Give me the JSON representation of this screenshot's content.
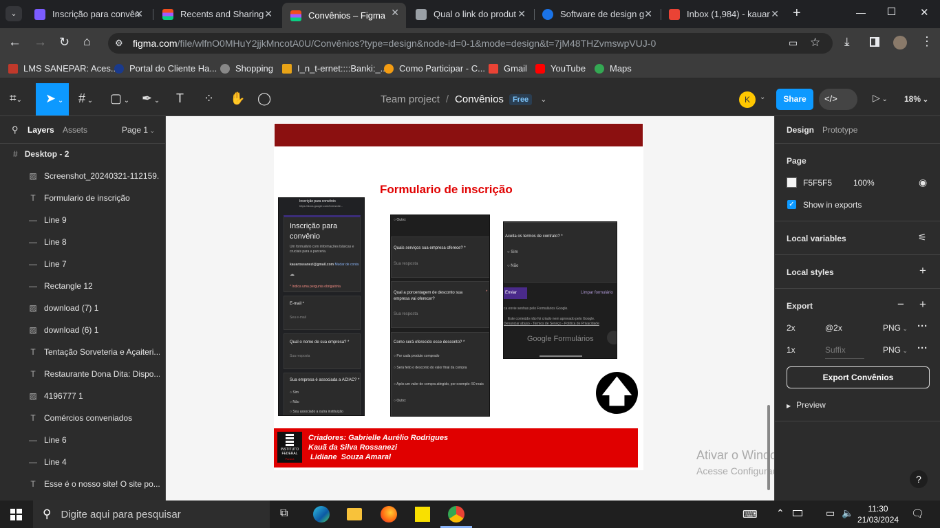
{
  "browser": {
    "tabs": [
      {
        "title": "Inscrição para convên",
        "color": "#7b5cff"
      },
      {
        "title": "Recents and Sharing -",
        "color": "#f24e1e"
      },
      {
        "title": "Convênios – Figma",
        "color": "#f24e1e"
      },
      {
        "title": "Qual o link do produt",
        "color": "#9aa0a6"
      },
      {
        "title": "Software de design g",
        "color": "#1a73e8"
      },
      {
        "title": "Inbox (1,984) - kauar",
        "color": "#ea4335"
      }
    ],
    "new_tab": "+",
    "url_host": "figma.com",
    "url_path": "/file/wlfnO0MHuY2jjkMncotA0U/Convênios?type=design&node-id=0-1&mode=design&t=7jM48THZvmswpVUJ-0",
    "bookmarks": [
      "LMS SANEPAR: Aces...",
      "Portal do Cliente Ha...",
      "Shopping",
      "I_n_t-ernet::::Banki:_...",
      "Como Participar - C...",
      "Gmail",
      "YouTube",
      "Maps"
    ]
  },
  "figma": {
    "breadcrumb_team": "Team project",
    "breadcrumb_sep": "/",
    "file_name": "Convênios",
    "plan_badge": "Free",
    "avatar_letter": "K",
    "share_label": "Share",
    "zoom": "18%",
    "left": {
      "tab_layers": "Layers",
      "tab_assets": "Assets",
      "page": "Page 1",
      "frame": "Desktop - 2",
      "layers": [
        {
          "icon": "image",
          "name": "Screenshot_20240321-112159..."
        },
        {
          "icon": "text",
          "name": "Formulario de inscrição"
        },
        {
          "icon": "line",
          "name": "Line 9"
        },
        {
          "icon": "line",
          "name": "Line 8"
        },
        {
          "icon": "line",
          "name": "Line 7"
        },
        {
          "icon": "line",
          "name": "Rectangle 12"
        },
        {
          "icon": "image",
          "name": "download (7) 1"
        },
        {
          "icon": "image",
          "name": "download (6) 1"
        },
        {
          "icon": "text",
          "name": "Tentação Sorveteria e Açaiteri..."
        },
        {
          "icon": "text",
          "name": "Restaurante Dona Dita: Dispo..."
        },
        {
          "icon": "image",
          "name": "4196777 1"
        },
        {
          "icon": "text",
          "name": "Comércios conveniados"
        },
        {
          "icon": "line",
          "name": "Line 6"
        },
        {
          "icon": "line",
          "name": "Line 4"
        },
        {
          "icon": "text",
          "name": "Esse é o nosso site! O site po..."
        }
      ]
    },
    "right": {
      "tab_design": "Design",
      "tab_prototype": "Prototype",
      "page_label": "Page",
      "page_color": "F5F5F5",
      "page_opacity": "100%",
      "page_color_hex": "#F5F5F5",
      "show_in_exports": "Show in exports",
      "local_variables": "Local variables",
      "local_styles": "Local styles",
      "export_label": "Export",
      "exports": [
        {
          "scale": "2x",
          "suffix": "@2x",
          "format": "PNG"
        },
        {
          "scale": "1x",
          "suffix": "Suffix",
          "format": "PNG"
        }
      ],
      "export_button": "Export Convênios",
      "preview": "Preview"
    },
    "canvas": {
      "form_title": "Formulario de inscrição",
      "credits_1": "Criadores: Gabrielle Aurélio Rodrigues",
      "credits_2": "Kauã da Silva Rossanezi",
      "credits_3": " Lidiane  Souza Amaral",
      "logo_text": "INSTITUTO FEDERAL",
      "logo_sub": "Paraná",
      "phone1": {
        "topbar": "Inscrição para convênio",
        "url": "https://docs.google.com/forms/d/e...",
        "heading": "Inscrição para convênio",
        "desc": "Um formulário com informações básicas e cruciais para a parceria.",
        "email": "kauarossanezi@gmail.com",
        "switch": "Mudar de conta",
        "required": "* Indica uma pergunta obrigatória",
        "q1": "E-mail *",
        "q1_ph": "Seu e-mail",
        "q2": "Qual o nome de sua empresa? *",
        "q2_ph": "Sua resposta",
        "q3": "Sua empresa é associada a ACIAC? *",
        "opts": [
          "Sim",
          "Não",
          "Sou associado a outra instituição"
        ]
      },
      "phone2": {
        "other": "Outro:",
        "q1": "Quais serviços sua empresa oferece? *",
        "q1_ph": "Sua resposta",
        "q2": "Qual a porcentagem de desconto sua empresa vai oferecer?",
        "q2_star": "*",
        "q2_ph": "Sua resposta",
        "q3": "Como será oferecido esse desconto? *",
        "opts": [
          "Por cada produto comprado",
          "Será feito o desconto do valor final da compra",
          "Após um valor de compra atingido, por exemplo: 50 reais",
          "Outro:"
        ]
      },
      "phone3": {
        "q": "Aceita os termos de contrato? *",
        "opts": [
          "Sim",
          "Não"
        ],
        "submit": "Enviar",
        "clear": "Limpar formulário",
        "note": "ca envie senhas pelo Formulários Google.",
        "disclaimer": "Este conteúdo não foi criado nem aprovado pelo Google.",
        "links": "Denunciar abuso - Termos de Serviço - Política de Privacidade",
        "brand": "Google Formulários"
      }
    }
  },
  "watermark": {
    "title": "Ativar o Windows",
    "sub": "Acesse Configurações para ativar o Windows."
  },
  "taskbar": {
    "search_placeholder": "Digite aqui para pesquisar",
    "time": "11:30",
    "date": "21/03/2024"
  }
}
